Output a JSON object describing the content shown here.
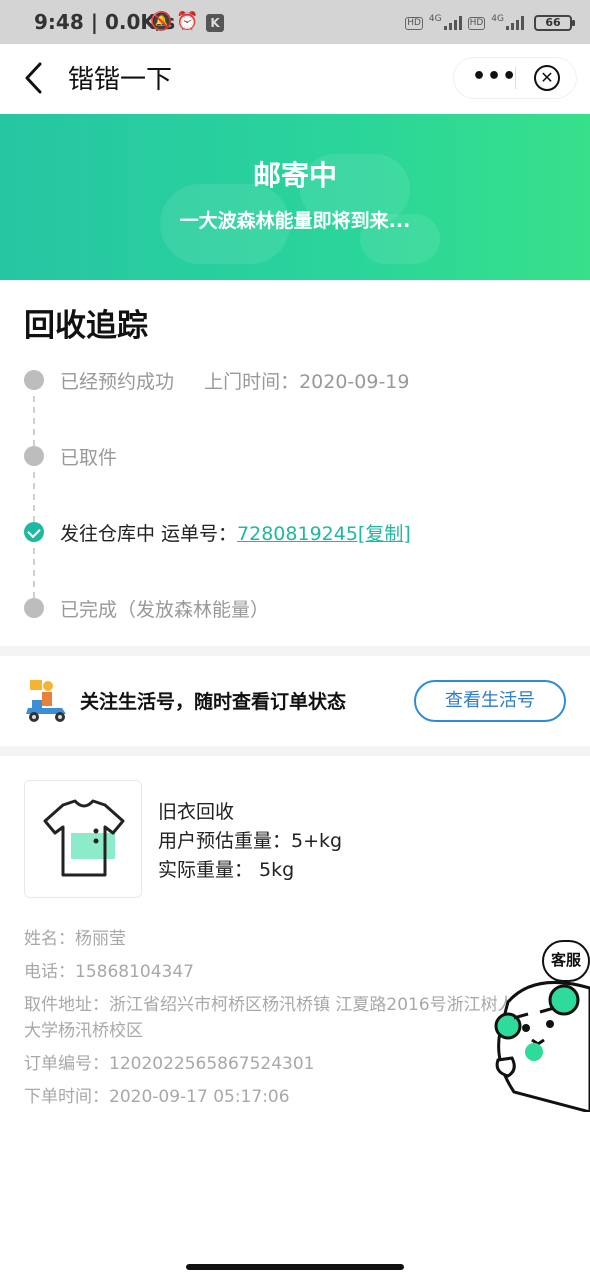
{
  "status_bar": {
    "time": "9:48",
    "speed": "| 0.0K/s",
    "network_1": "4G",
    "network_2": "4G",
    "hd_1": "HD",
    "hd_2": "HD",
    "battery": "66"
  },
  "titlebar": {
    "title": "锴锴一下",
    "more_label": "•••",
    "close_label": "✕"
  },
  "banner": {
    "title": "邮寄中",
    "subtitle": "一大波森林能量即将到来..."
  },
  "tracking": {
    "title": "回收追踪",
    "steps": [
      {
        "label": "已经预约成功",
        "extra": "上门时间：2020-09-19",
        "state": "done"
      },
      {
        "label": "已取件",
        "state": "done"
      },
      {
        "label": "发往仓库中 运单号：",
        "link": "7280819245[复制]",
        "state": "active"
      },
      {
        "label": "已完成（发放森林能量）",
        "state": "pending"
      }
    ]
  },
  "follow": {
    "text": "关注生活号，随时查看订单状态",
    "button": "查看生活号"
  },
  "order": {
    "product_name": "旧衣回收",
    "estimated_weight": "用户预估重量：5+kg",
    "actual_weight": "实际重量：  5kg",
    "name": "姓名：杨丽莹",
    "phone": "电话：15868104347",
    "address_line1": "取件地址：浙江省绍兴市柯桥区杨汛桥镇 江夏路2016号浙江树人",
    "address_line2": "大学杨汛桥校区",
    "order_no": "订单编号：1202022565867524301",
    "order_time": "下单时间：2020-09-17 05:17:06"
  },
  "service": {
    "label": "客服"
  },
  "colors": {
    "accent": "#1fb8a0",
    "banner_start": "#26c6a3",
    "banner_end": "#37e08a",
    "button_blue": "#2e7bd0"
  }
}
